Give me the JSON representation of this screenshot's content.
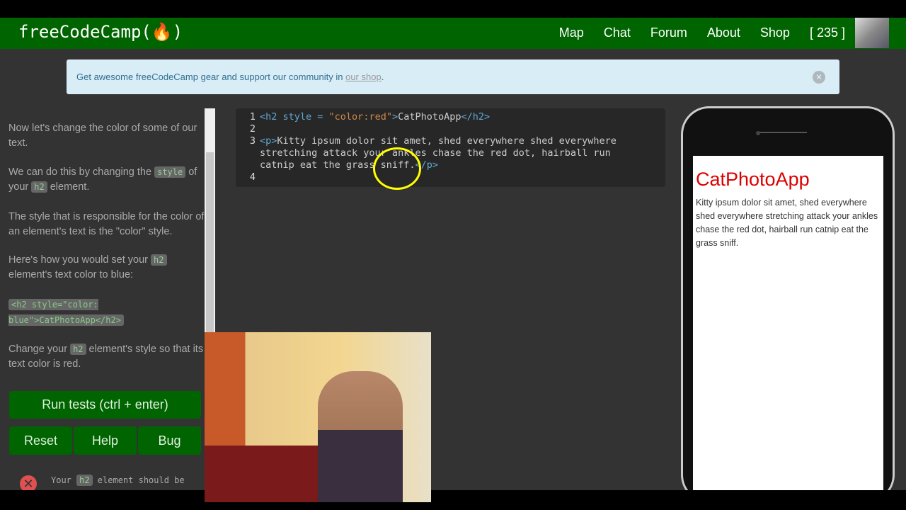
{
  "nav": {
    "logo": "freeCodeCamp(🔥)",
    "links": [
      "Map",
      "Chat",
      "Forum",
      "About",
      "Shop",
      "[ 235 ]"
    ]
  },
  "banner": {
    "text": "Get awesome freeCodeCamp gear and support our community in ",
    "link": "our shop",
    "end": "."
  },
  "instructions": {
    "p1": "Now let's change the color of some of our text.",
    "p2a": "We can do this by changing the ",
    "p2code": "style",
    "p2b": " of your ",
    "p2code2": "h2",
    "p2c": " element.",
    "p3": "The style that is responsible for the color of an element's text is the \"color\" style.",
    "p4a": "Here's how you would set your ",
    "p4code": "h2",
    "p4b": " element's text color to blue:",
    "example": "<h2 style=\"color: blue\">CatPhotoApp</h2>",
    "p5a": "Change your ",
    "p5code": "h2",
    "p5b": " element's style so that its text color is red."
  },
  "buttons": {
    "run": "Run tests (ctrl + enter)",
    "reset": "Reset",
    "help": "Help",
    "bug": "Bug"
  },
  "test": {
    "a": "Your ",
    "code": "h2",
    "b": " element should be"
  },
  "editor": {
    "l1a": "<h2 style = ",
    "l1s": "\"color:red\"",
    "l1b": ">",
    "l1t": "CatPhotoApp",
    "l1c": "</h2>",
    "l3a": "<p>",
    "l3t": "Kitty ipsum dolor sit amet, shed everywhere shed everywhere",
    "l3t2": "stretching attack your ankles chase the red dot, hairball run",
    "l3t3": "catnip eat the grass sniff.",
    "l3c": "</p>"
  },
  "preview": {
    "title": "CatPhotoApp",
    "text": "Kitty ipsum dolor sit amet, shed everywhere shed everywhere stretching attack your ankles chase the red dot, hairball run catnip eat the grass sniff."
  }
}
